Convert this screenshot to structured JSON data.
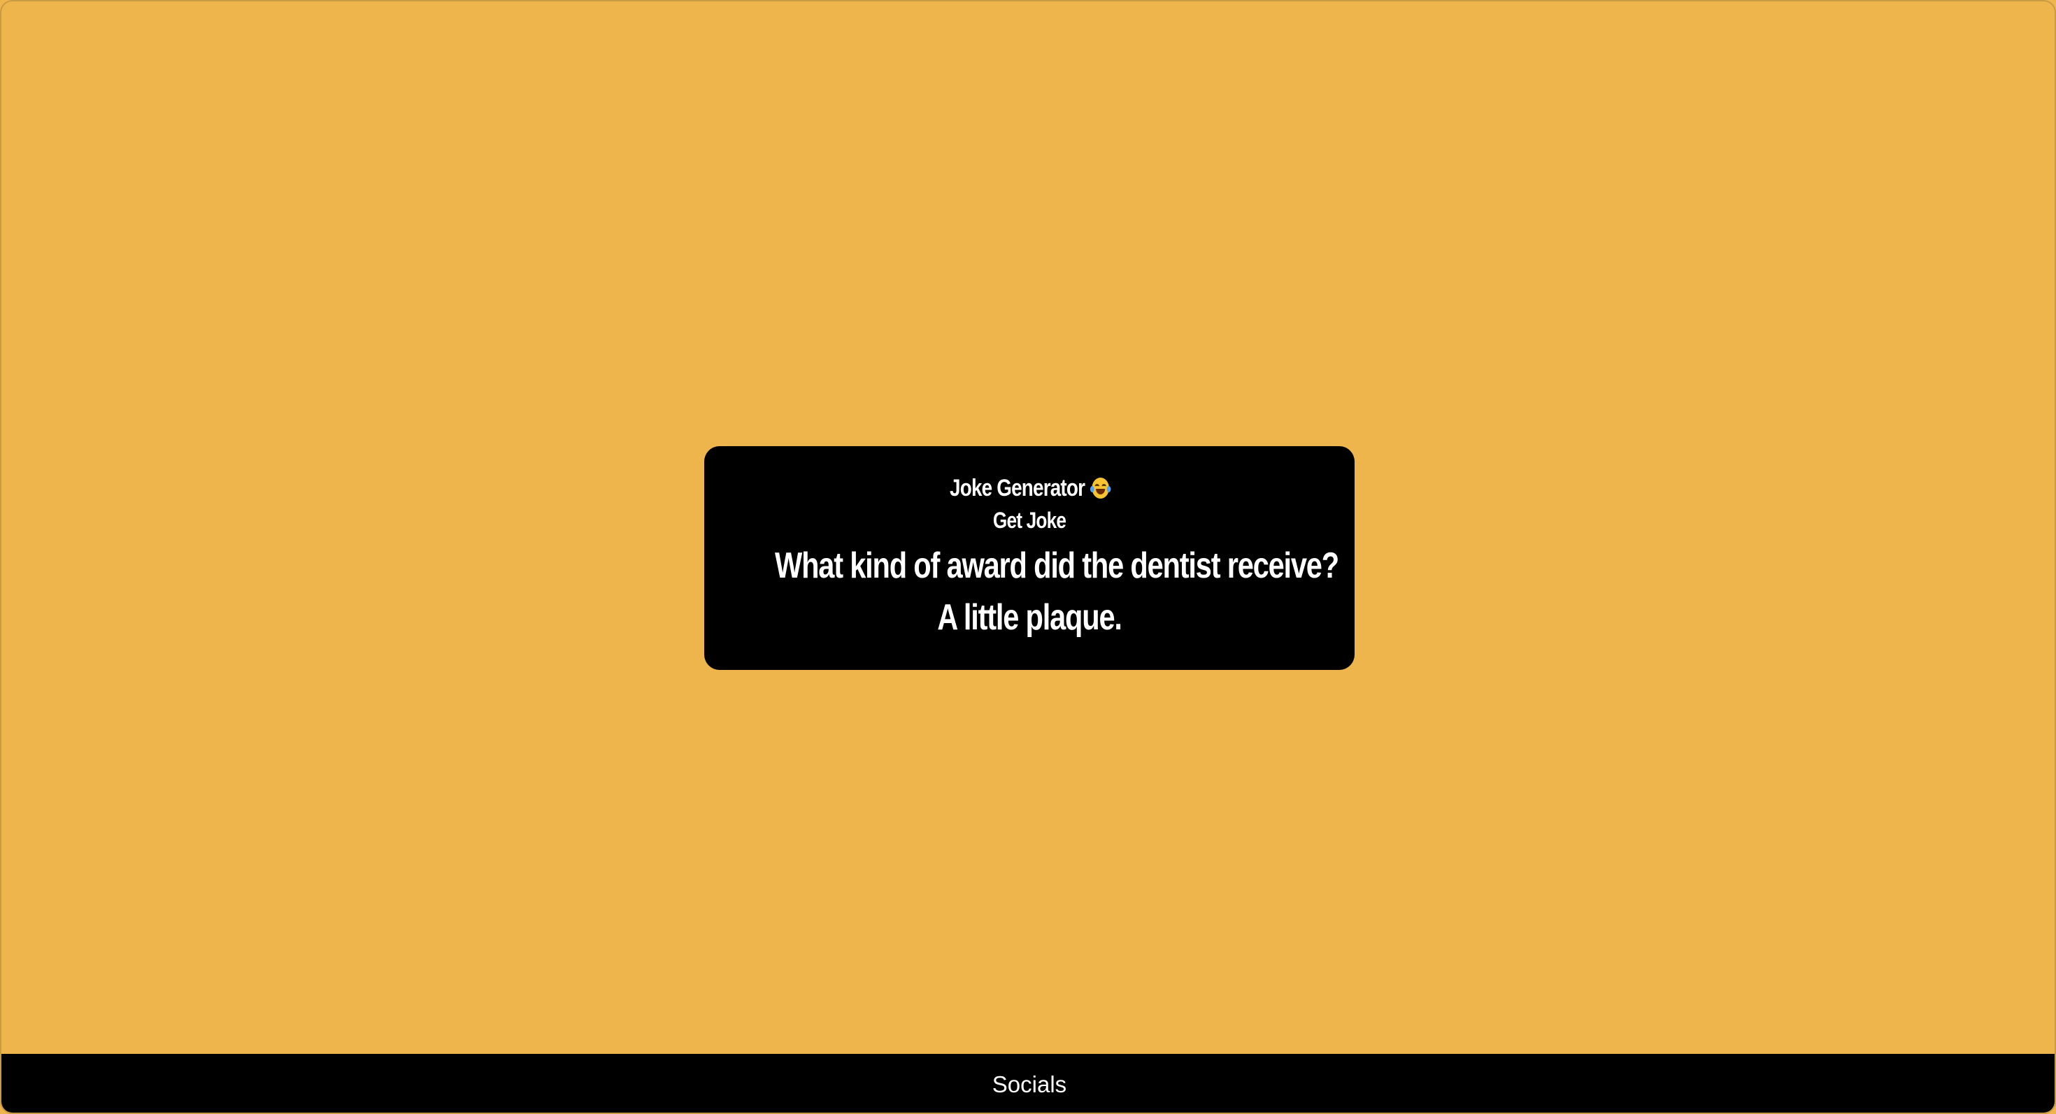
{
  "colors": {
    "background": "#efb54d",
    "card": "#000000",
    "text": "#ffffff",
    "footer": "#000000"
  },
  "card": {
    "title": "Joke Generator",
    "title_icon": "laughing-tears-emoji-icon",
    "button_label": "Get Joke",
    "joke_line1": "What kind of award did the dentist receive?",
    "joke_line2": "A little plaque."
  },
  "footer": {
    "link_label": "Socials"
  }
}
